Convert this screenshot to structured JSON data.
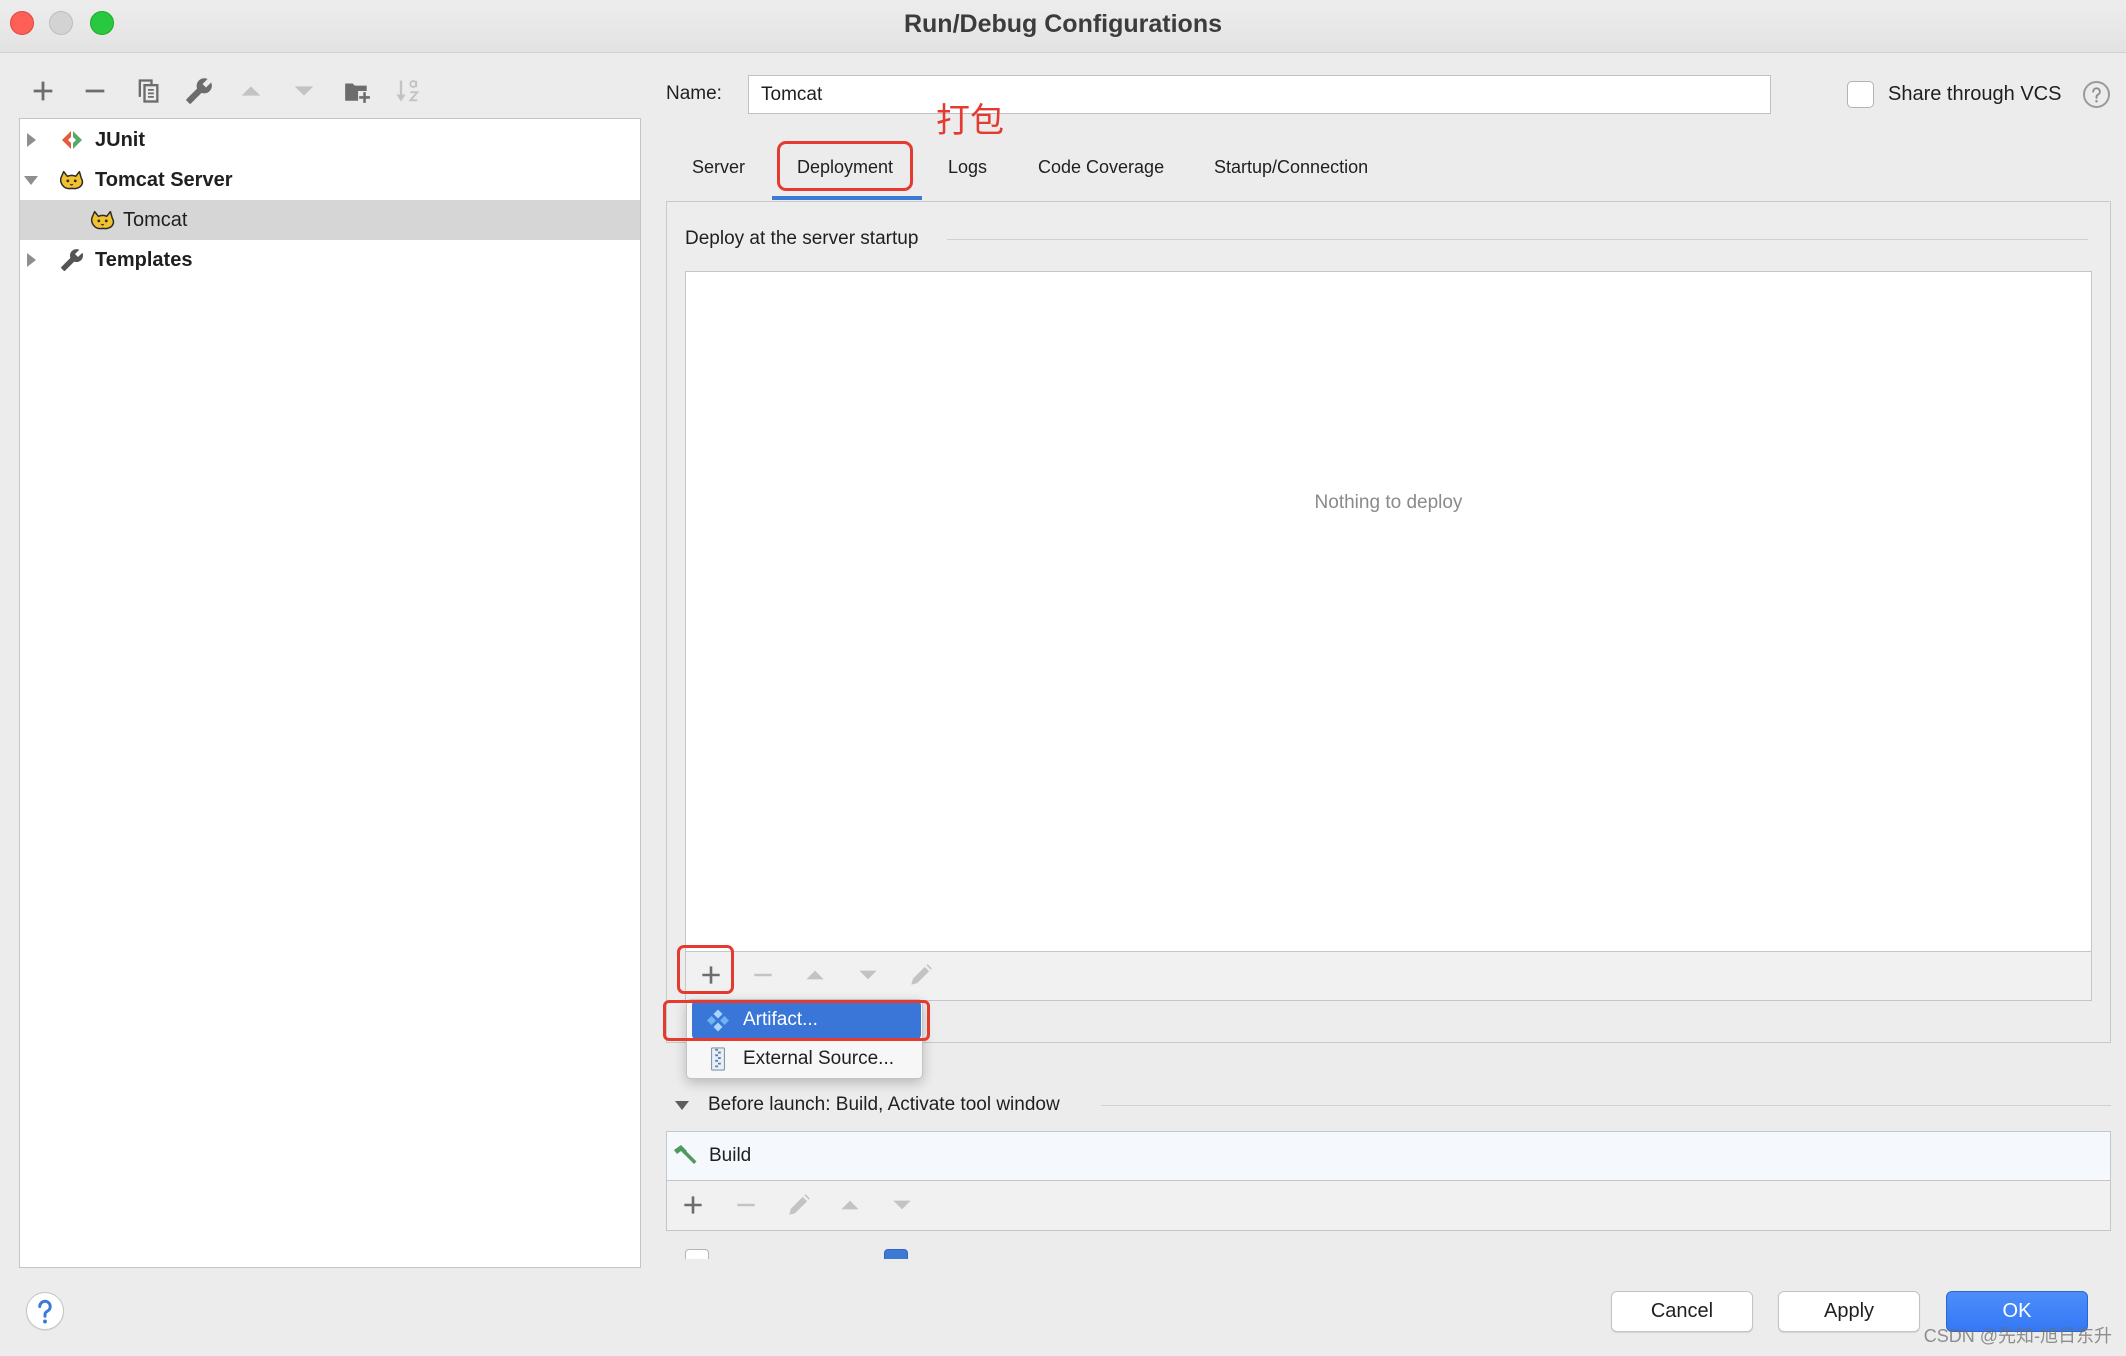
{
  "window": {
    "title": "Run/Debug Configurations"
  },
  "left_toolbar": {
    "icons": [
      "add-icon",
      "remove-icon",
      "copy-icon",
      "wrench-icon",
      "move-up-icon",
      "move-down-icon",
      "new-folder-icon",
      "sort-alphabetically-icon"
    ]
  },
  "tree": {
    "items": [
      {
        "label": "JUnit",
        "icon": "junit-icon",
        "expanded": false
      },
      {
        "label": "Tomcat Server",
        "icon": "tomcat-icon",
        "expanded": true,
        "children": [
          {
            "label": "Tomcat",
            "icon": "tomcat-icon",
            "selected": true
          }
        ]
      },
      {
        "label": "Templates",
        "icon": "wrench-icon",
        "expanded": false
      }
    ]
  },
  "name_field": {
    "label": "Name:",
    "value": "Tomcat"
  },
  "share_vcs": {
    "label": "Share through VCS",
    "checked": false
  },
  "annotation": {
    "text": "打包"
  },
  "tabs": [
    {
      "label": "Server",
      "active": false
    },
    {
      "label": "Deployment",
      "active": true
    },
    {
      "label": "Logs",
      "active": false
    },
    {
      "label": "Code Coverage",
      "active": false
    },
    {
      "label": "Startup/Connection",
      "active": false
    }
  ],
  "deployment": {
    "section_title": "Deploy at the server startup",
    "empty_text": "Nothing to deploy",
    "toolbar_icons": [
      "add-icon",
      "remove-icon",
      "move-up-icon",
      "move-down-icon",
      "edit-icon"
    ]
  },
  "add_menu": {
    "items": [
      {
        "label": "Artifact...",
        "icon": "artifact-icon",
        "selected": true
      },
      {
        "label": "External Source...",
        "icon": "external-source-icon",
        "selected": false
      }
    ]
  },
  "before_launch": {
    "title": "Before launch: Build, Activate tool window",
    "expanded": true,
    "tasks": [
      {
        "label": "Build",
        "icon": "build-icon"
      }
    ],
    "toolbar_icons": [
      "add-icon",
      "remove-icon",
      "edit-icon",
      "move-up-icon",
      "move-down-icon"
    ]
  },
  "options": {
    "checkboxes": [
      {
        "checked": false
      },
      {
        "checked": true
      }
    ]
  },
  "buttons": {
    "cancel": "Cancel",
    "apply": "Apply",
    "ok": "OK"
  },
  "watermark": "CSDN @先知-旭日东升",
  "colors": {
    "accent": "#3d7ad6",
    "annotation": "#e53a2f",
    "selection": "#3a76d8",
    "ok_button": "#3478f6",
    "close": "#fe5f57",
    "minimize": "#d3d3d3",
    "zoom": "#28c840"
  }
}
